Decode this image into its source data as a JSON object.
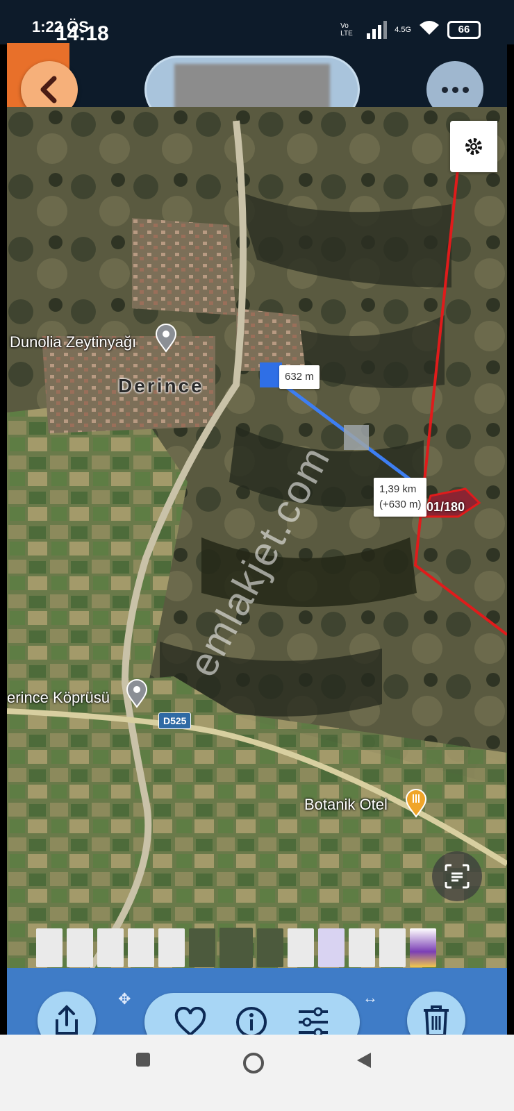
{
  "status_bar": {
    "time_back": "1:22 ÖS",
    "time_front": "14:18",
    "network": "4.5G",
    "volte": "Vo LTE",
    "battery": "66"
  },
  "header": {
    "title_hidden": true
  },
  "map": {
    "places": [
      {
        "name": "Dunolia Zeytinyağı"
      },
      {
        "name": "Derince"
      },
      {
        "name": "erince Köprüsü"
      },
      {
        "name": "Botanik Otel"
      }
    ],
    "road_badge": "D525",
    "measure_start": "632 m",
    "measure_end_line1": "1,39 km",
    "measure_end_line2": "(+630 m)",
    "parcel": "01/180",
    "watermark": "emlakjet.com",
    "colors": {
      "measure_line": "#3d7ef2",
      "parcel_border": "#e01b1b"
    }
  },
  "toolbar": {
    "icons": [
      "share-icon",
      "heart-icon",
      "info-icon",
      "sliders-icon",
      "trash-icon"
    ]
  },
  "nav": {
    "buttons": [
      "recent-apps",
      "home",
      "back"
    ]
  }
}
